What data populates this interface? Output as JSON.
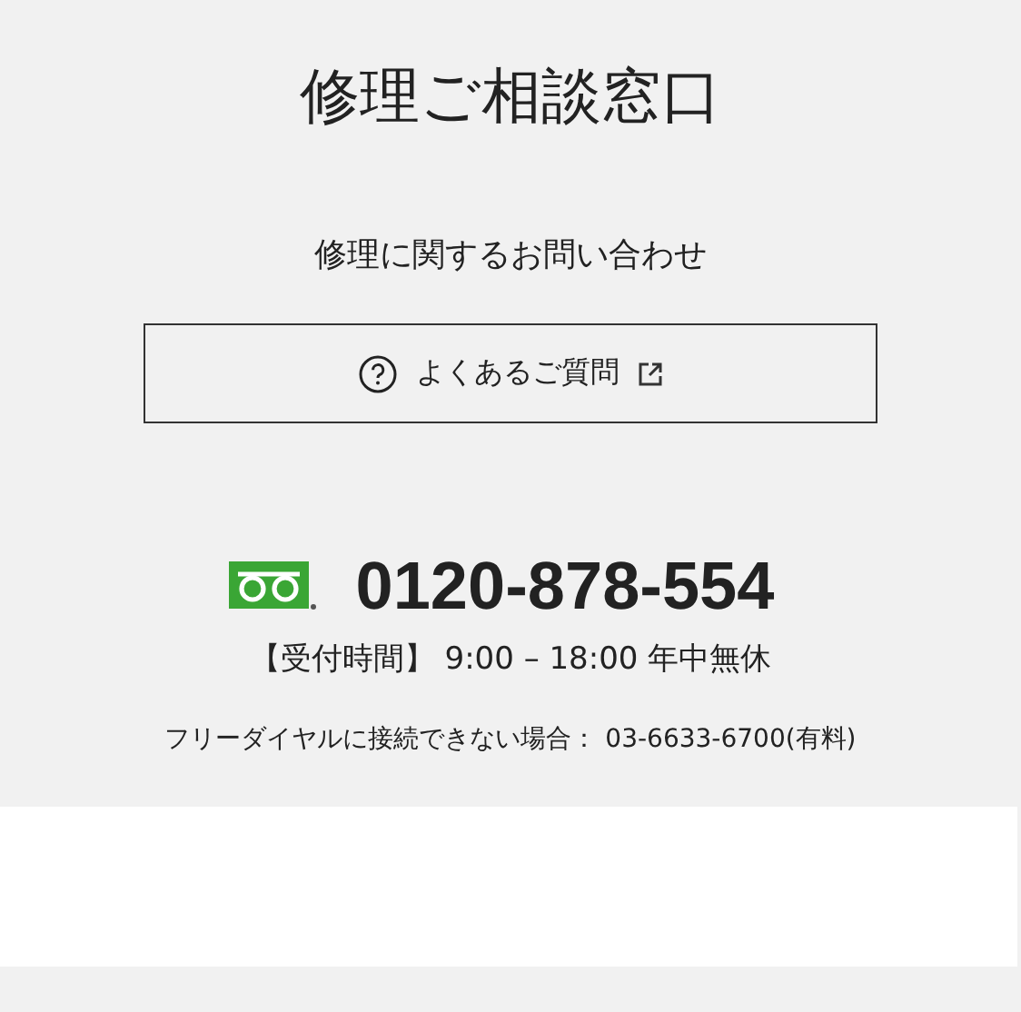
{
  "title": "修理ご相談窓口",
  "subtitle": "修理に関するお問い合わせ",
  "faq_button": {
    "label": "よくあるご質問"
  },
  "phone": {
    "number": "0120-878-554",
    "hours": "【受付時間】 9:00 – 18:00 年中無休",
    "alt_note": "フリーダイヤルに接続できない場合： 03-6633-6700(有料)"
  }
}
